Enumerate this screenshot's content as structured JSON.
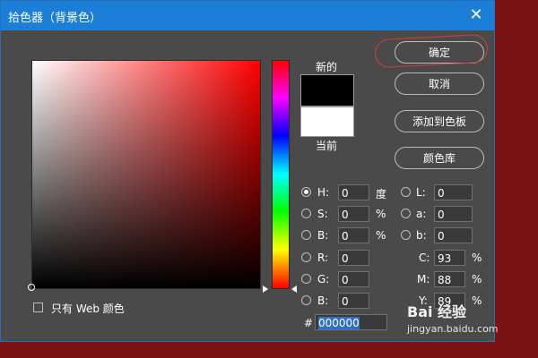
{
  "dialog": {
    "title": "拾色器（背景色）",
    "close_icon": "close-icon"
  },
  "buttons": {
    "ok": "确定",
    "cancel": "取消",
    "add_to_swatches": "添加到色板",
    "color_libraries": "颜色库"
  },
  "preview": {
    "new_label": "新的",
    "current_label": "当前",
    "new_color": "#000000",
    "current_color": "#ffffff"
  },
  "hsb": [
    {
      "label": "H:",
      "value": "0",
      "unit": "度",
      "selected": true
    },
    {
      "label": "S:",
      "value": "0",
      "unit": "%",
      "selected": false
    },
    {
      "label": "B:",
      "value": "0",
      "unit": "%",
      "selected": false
    }
  ],
  "lab": [
    {
      "label": "L:",
      "value": "0"
    },
    {
      "label": "a:",
      "value": "0"
    },
    {
      "label": "b:",
      "value": "0"
    }
  ],
  "rgb": [
    {
      "label": "R:",
      "value": "0"
    },
    {
      "label": "G:",
      "value": "0"
    },
    {
      "label": "B:",
      "value": "0"
    }
  ],
  "cmyk": [
    {
      "label": "C:",
      "value": "93",
      "unit": "%"
    },
    {
      "label": "M:",
      "value": "88",
      "unit": "%"
    },
    {
      "label": "Y:",
      "value": "89",
      "unit": "%"
    }
  ],
  "hex": {
    "label": "#",
    "value": "000000"
  },
  "web_only": {
    "label": "只有 Web 颜色",
    "checked": false
  },
  "watermark": {
    "text": "Bai 经验",
    "sub": "jingyan.baidu.com"
  }
}
